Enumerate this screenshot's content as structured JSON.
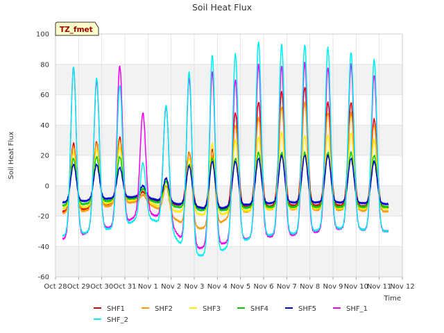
{
  "chart_data": {
    "type": "line",
    "title": "Soil Heat Flux",
    "xlabel": "Time",
    "ylabel": "Soil Heat Flux",
    "annotation": "TZ_fmet",
    "xlim": [
      0,
      15
    ],
    "ylim": [
      -60,
      100
    ],
    "yticks": [
      -60,
      -40,
      -20,
      0,
      20,
      40,
      60,
      80,
      100
    ],
    "xticks": [
      0,
      1,
      2,
      3,
      4,
      5,
      6,
      7,
      8,
      9,
      10,
      11,
      12,
      13,
      14,
      15
    ],
    "xticklabels": [
      "Oct 28",
      "Oct 29",
      "Oct 30",
      "Oct 31",
      "Nov 1",
      "Nov 2",
      "Nov 3",
      "Nov 4",
      "Nov 5",
      "Nov 6",
      "Nov 7",
      "Nov 8",
      "Nov 9",
      "Nov 10",
      "Nov 11",
      "Nov 12"
    ],
    "x_start": 0.3,
    "x_end": 14.4,
    "peak_x": [
      0.78,
      1.78,
      2.78,
      3.78,
      4.78,
      5.78,
      6.78,
      7.78,
      8.78,
      9.78,
      10.78,
      11.78,
      12.78,
      13.78
    ],
    "grid": true,
    "legend_position": "bottom",
    "series": [
      {
        "name": "SHF1",
        "color": "#dd0000",
        "base": [
          -17,
          -14,
          -10,
          -8,
          -12,
          -13,
          -16,
          -14,
          -14,
          -13,
          -13,
          -13,
          -13,
          -14
        ],
        "peak": [
          28,
          29,
          32,
          -4,
          5,
          22,
          24,
          48,
          55,
          62,
          65,
          55,
          55,
          44
        ]
      },
      {
        "name": "SHF2",
        "color": "#ff9900",
        "base": [
          -18,
          -15,
          -12,
          -10,
          -18,
          -28,
          -28,
          -18,
          -16,
          -15,
          -16,
          -16,
          -16,
          -17
        ],
        "peak": [
          26,
          28,
          30,
          -6,
          0,
          22,
          20,
          40,
          45,
          52,
          55,
          48,
          48,
          40
        ]
      },
      {
        "name": "SHF3",
        "color": "#ffee00",
        "base": [
          -15,
          -13,
          -10,
          -9,
          -16,
          -18,
          -20,
          -17,
          -16,
          -15,
          -15,
          -15,
          -15,
          -15
        ],
        "peak": [
          22,
          24,
          25,
          -2,
          3,
          18,
          28,
          30,
          32,
          35,
          33,
          33,
          35,
          30
        ]
      },
      {
        "name": "SHF4",
        "color": "#00cc00",
        "base": [
          -13,
          -11,
          -9,
          -8,
          -13,
          -15,
          -17,
          -15,
          -14,
          -14,
          -14,
          -14,
          -14,
          -14
        ],
        "peak": [
          18,
          19,
          19,
          -2,
          3,
          14,
          18,
          18,
          22,
          22,
          22,
          22,
          22,
          20
        ]
      },
      {
        "name": "SHF5",
        "color": "#0000cc",
        "base": [
          -11,
          -9,
          -8,
          -7,
          -11,
          -13,
          -16,
          -13,
          -12,
          -11,
          -11,
          -11,
          -11,
          -12
        ],
        "peak": [
          14,
          14,
          12,
          0,
          5,
          13,
          16,
          16,
          18,
          20,
          20,
          20,
          18,
          16
        ]
      },
      {
        "name": "SHF_1",
        "color": "#ee00ee",
        "base": [
          -35,
          -28,
          -27,
          -17,
          -22,
          -42,
          -40,
          -36,
          -34,
          -33,
          -32,
          -29,
          -28,
          -30
        ],
        "peak": [
          78,
          69,
          79,
          48,
          52,
          71,
          75,
          70,
          80,
          79,
          81,
          78,
          80,
          73
        ]
      },
      {
        "name": "SHF_2",
        "color": "#00eeee",
        "base": [
          -33,
          -29,
          -28,
          -20,
          -26,
          -46,
          -46,
          -38,
          -33,
          -32,
          -31,
          -28,
          -28,
          -30
        ],
        "peak": [
          78,
          71,
          66,
          15,
          53,
          75,
          86,
          87,
          95,
          93,
          93,
          91,
          88,
          83
        ]
      }
    ]
  }
}
